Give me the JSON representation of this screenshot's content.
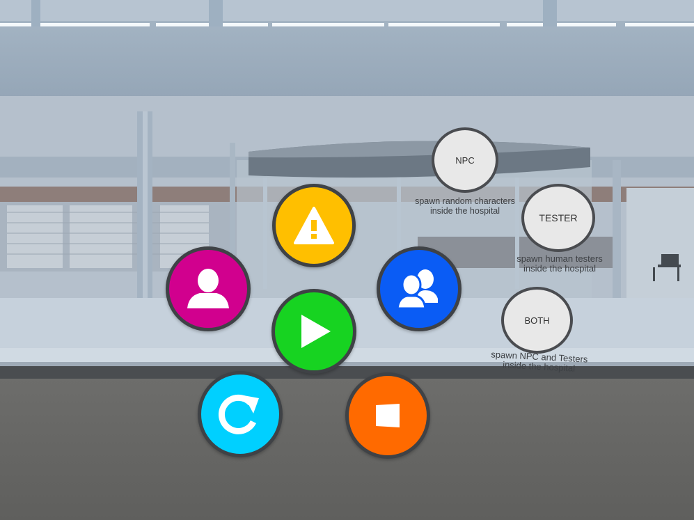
{
  "menu": {
    "warning_button": {
      "icon": "warning-icon",
      "color": "#ffbf00"
    },
    "person_button": {
      "icon": "person-icon",
      "color": "#d1008e"
    },
    "group_button": {
      "icon": "group-icon",
      "color": "#0a5cf5"
    },
    "play_button": {
      "icon": "play-icon",
      "color": "#17d321"
    },
    "reset_button": {
      "icon": "refresh-icon",
      "color": "#00d0ff"
    },
    "stop_button": {
      "icon": "stop-icon",
      "color": "#ff6a00"
    }
  },
  "spawn_options": [
    {
      "label": "NPC",
      "description": "spawn random characters inside the hospital"
    },
    {
      "label": "TESTER",
      "description": "spawn human testers inside the hospital"
    },
    {
      "label": "BOTH",
      "description": "spawn NPC and Testers inside the hospital"
    }
  ]
}
